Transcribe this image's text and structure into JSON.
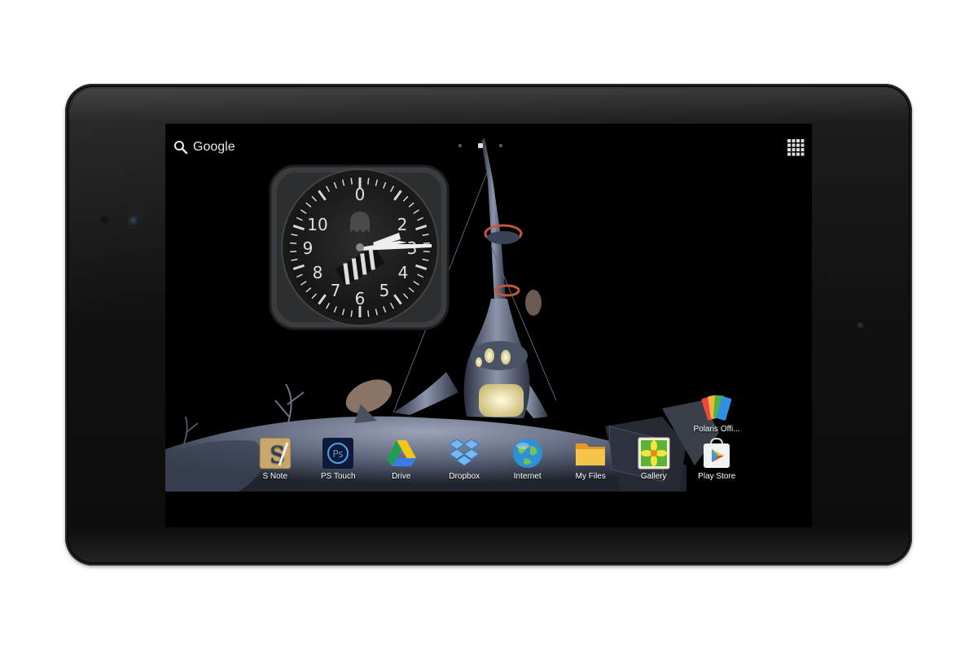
{
  "search": {
    "label": "Google"
  },
  "home_pages": {
    "count": 3,
    "active_index": 1
  },
  "clock": {
    "numerals": [
      "0",
      "2",
      "3",
      "4",
      "5",
      "6",
      "7",
      "8",
      "9",
      "10"
    ]
  },
  "dock": [
    {
      "label": "S Note",
      "icon": "s-note-icon"
    },
    {
      "label": "PS Touch",
      "icon": "ps-touch-icon"
    },
    {
      "label": "Drive",
      "icon": "drive-icon"
    },
    {
      "label": "Dropbox",
      "icon": "dropbox-icon"
    },
    {
      "label": "Internet",
      "icon": "internet-globe-icon"
    },
    {
      "label": "My Files",
      "icon": "folder-icon"
    },
    {
      "label": "Gallery",
      "icon": "gallery-flower-icon"
    },
    {
      "label": "Play Store",
      "icon": "play-store-icon"
    }
  ],
  "desktop_shortcut": {
    "label": "Polaris Offi...",
    "icon": "polaris-office-icon"
  },
  "colors": {
    "screen_bg": "#000000",
    "frame": "#111111",
    "icon_text": "#ffffff"
  }
}
